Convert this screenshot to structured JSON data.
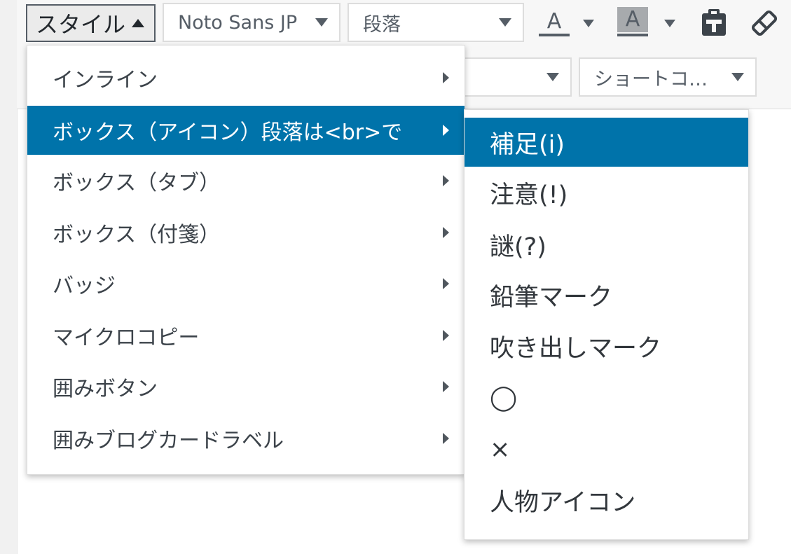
{
  "toolbar": {
    "style_label": "スタイル",
    "font_label": "Noto Sans JP",
    "format_label": "段落",
    "text_color_glyph": "A",
    "bg_color_glyph": "A",
    "shortcode_label": "ショートコ…",
    "icons": {
      "paste": "clipboard-icon",
      "clear": "eraser-icon"
    }
  },
  "style_menu": {
    "items": [
      {
        "label": "インライン"
      },
      {
        "label": "ボックス（アイコン）段落は<br>で",
        "active": true
      },
      {
        "label": "ボックス（タブ）"
      },
      {
        "label": "ボックス（付箋）"
      },
      {
        "label": "バッジ"
      },
      {
        "label": "マイクロコピー"
      },
      {
        "label": "囲みボタン"
      },
      {
        "label": "囲みブログカードラベル"
      }
    ]
  },
  "submenu": {
    "items": [
      {
        "label": "補足(i)",
        "active": true
      },
      {
        "label": "注意(!)"
      },
      {
        "label": "謎(?)"
      },
      {
        "label": "鉛筆マーク"
      },
      {
        "label": "吹き出しマーク"
      },
      {
        "label": "◯"
      },
      {
        "label": "×"
      },
      {
        "label": "人物アイコン"
      }
    ]
  },
  "colors": {
    "accent": "#0073aa",
    "toolbar_bg": "#f7f7f7"
  }
}
